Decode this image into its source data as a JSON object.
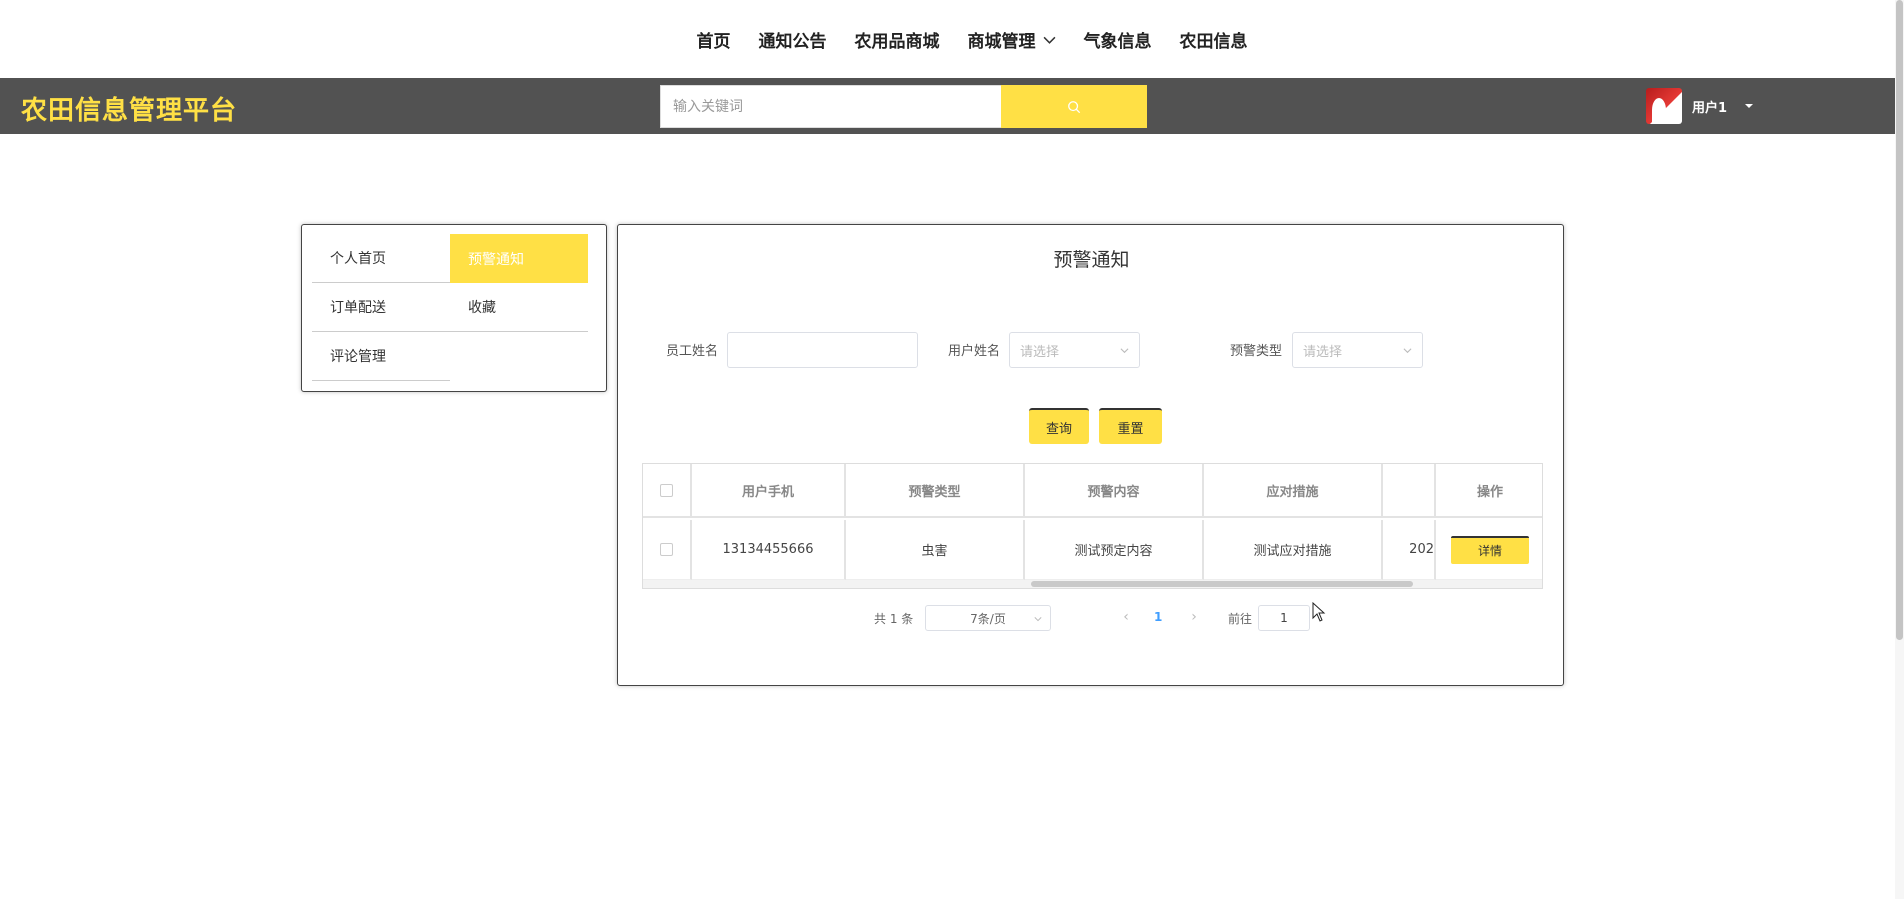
{
  "topnav": {
    "items": [
      "首页",
      "通知公告",
      "农用品商城",
      "商城管理",
      "气象信息",
      "农田信息"
    ]
  },
  "header": {
    "brand": "农田信息管理平台",
    "search_placeholder": "输入关键词",
    "user_name": "用户1",
    "accent_color": "#ffe045"
  },
  "side_menu": {
    "items": [
      "个人首页",
      "预警通知",
      "订单配送",
      "收藏",
      "评论管理"
    ],
    "active": "预警通知"
  },
  "panel": {
    "title": "预警通知",
    "filters": {
      "employee_label": "员工姓名",
      "employee_value": "",
      "user_label": "用户姓名",
      "user_placeholder": "请选择",
      "type_label": "预警类型",
      "type_placeholder": "请选择"
    },
    "buttons": {
      "query": "查询",
      "reset": "重置"
    },
    "table": {
      "headers": [
        "用户手机",
        "预警类型",
        "预警内容",
        "应对措施",
        "",
        "操作"
      ],
      "rows": [
        {
          "phone": "13134455666",
          "type": "虫害",
          "content": "测试预定内容",
          "measure": "测试应对措施",
          "date_partial": "202",
          "action": "详情"
        }
      ]
    },
    "pagination": {
      "total": "共 1 条",
      "page_size": "7条/页",
      "current_page": "1",
      "goto_label": "前往",
      "goto_value": "1"
    }
  }
}
